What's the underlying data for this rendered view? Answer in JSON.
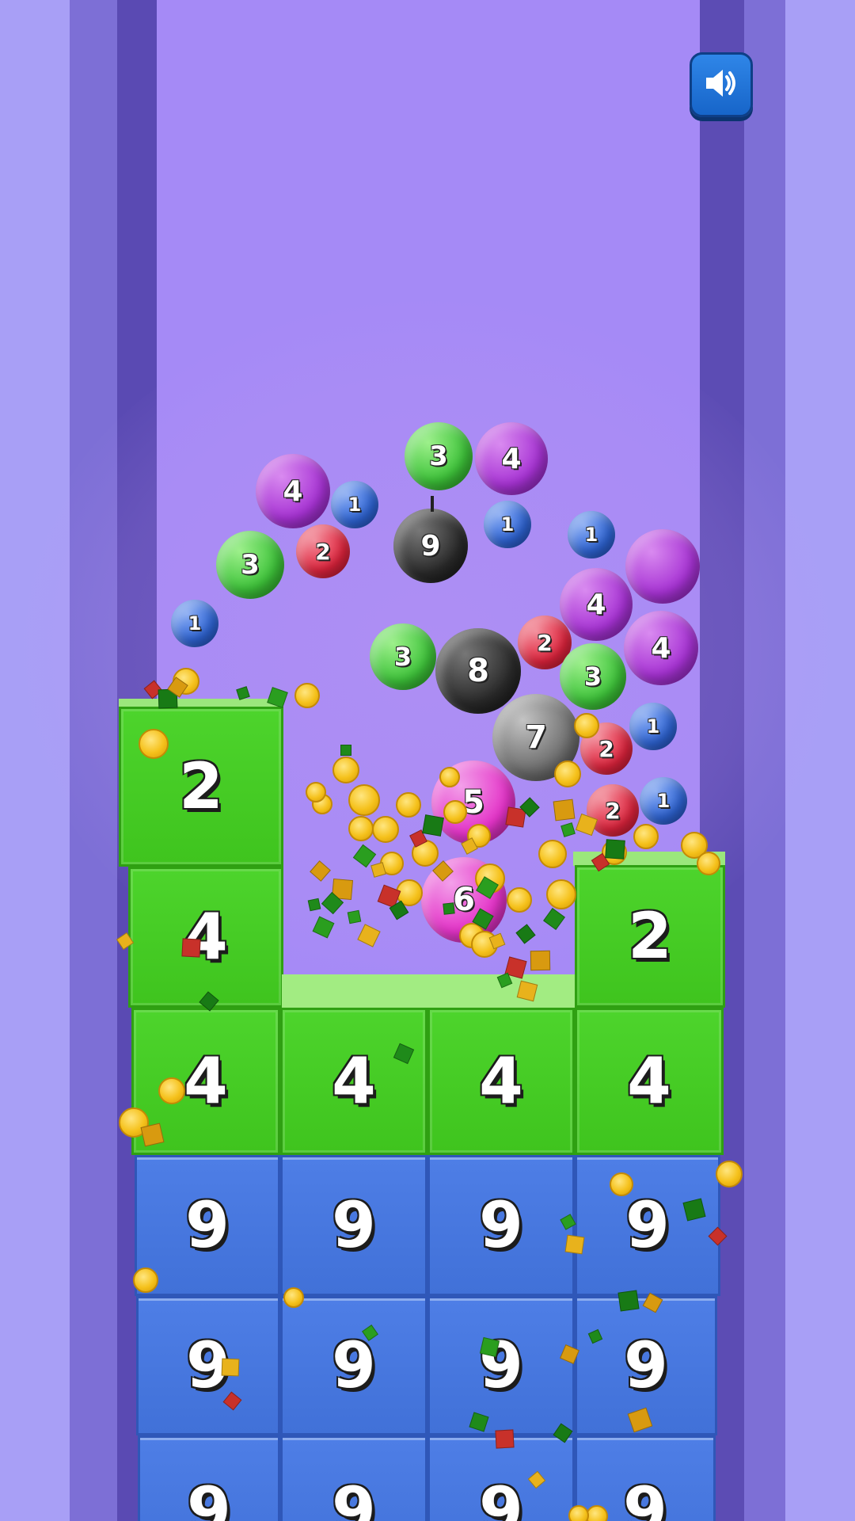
{
  "sound_button": {
    "icon": "speaker-on-icon"
  },
  "balls": [
    {
      "label": "4",
      "color": "#a733d4"
    },
    {
      "label": "1",
      "color": "#2f66d8"
    },
    {
      "label": "3",
      "color": "#3ec33a"
    },
    {
      "label": "4",
      "color": "#a733d4"
    },
    {
      "label": "2",
      "color": "#e0243d"
    },
    {
      "label": "9",
      "color": "#2a2a2a"
    },
    {
      "label": "1",
      "color": "#2f66d8"
    },
    {
      "label": "3",
      "color": "#3ec33a"
    },
    {
      "label": "1",
      "color": "#2f66d8"
    },
    {
      "label": "1",
      "color": "#2f66d8"
    },
    {
      "label": "",
      "color": "#a733d4"
    },
    {
      "label": "4",
      "color": "#a733d4"
    },
    {
      "label": "4",
      "color": "#a733d4"
    },
    {
      "label": "3",
      "color": "#3ec33a"
    },
    {
      "label": "8",
      "color": "#2a2a2a"
    },
    {
      "label": "2",
      "color": "#e0243d"
    },
    {
      "label": "3",
      "color": "#3ec33a"
    },
    {
      "label": "7",
      "color": "#6e6e6e"
    },
    {
      "label": "1",
      "color": "#2f66d8"
    },
    {
      "label": "2",
      "color": "#e0243d"
    },
    {
      "label": "1",
      "color": "#2f66d8"
    },
    {
      "label": "2",
      "color": "#e0243d"
    },
    {
      "label": "5",
      "color": "#e434c8"
    },
    {
      "label": "6",
      "color": "#e434c8"
    }
  ],
  "blocks": [
    {
      "label": "2",
      "color": "green"
    },
    {
      "label": "4",
      "color": "green"
    },
    {
      "label": "2",
      "color": "green"
    },
    {
      "label": "4",
      "color": "green"
    },
    {
      "label": "4",
      "color": "green"
    },
    {
      "label": "4",
      "color": "green"
    },
    {
      "label": "4",
      "color": "green"
    },
    {
      "label": "9",
      "color": "blue"
    },
    {
      "label": "9",
      "color": "blue"
    },
    {
      "label": "9",
      "color": "blue"
    },
    {
      "label": "9",
      "color": "blue"
    },
    {
      "label": "9",
      "color": "blue"
    },
    {
      "label": "9",
      "color": "blue"
    },
    {
      "label": "9",
      "color": "blue"
    },
    {
      "label": "9",
      "color": "blue"
    },
    {
      "label": "9",
      "color": "blue"
    },
    {
      "label": "9",
      "color": "blue"
    },
    {
      "label": "9",
      "color": "blue"
    },
    {
      "label": "9",
      "color": "blue"
    }
  ]
}
